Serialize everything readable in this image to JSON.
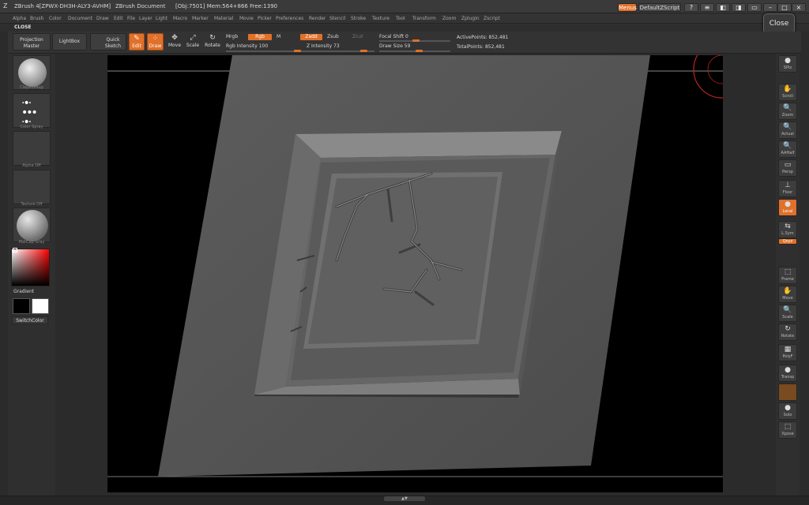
{
  "titlebar": {
    "app": "ZBrush 4[ZPWX-DH3H-ALY3-AVHM]",
    "document": "ZBrush Document",
    "stats": "[Obj:7501] Mem:564+866 Free:1390",
    "menus_label": "Menus",
    "script_label": "DefaultZScript"
  },
  "menubar": [
    "Alpha",
    "Brush",
    "Color",
    "Document",
    "Draw",
    "Edit",
    "File",
    "Layer",
    "Light",
    "Macro",
    "Marker",
    "Material",
    "Movie",
    "Picker",
    "Preferences",
    "Render",
    "Stencil",
    "Stroke",
    "Texture",
    "Tool",
    "Transform",
    "Zoom",
    "Zplugin",
    "Zscript"
  ],
  "closebar": {
    "label": "CLOSE"
  },
  "close_button": "Close",
  "toolbar": {
    "projection_master": [
      "Projection",
      "Master"
    ],
    "lightbox": "LightBox",
    "quick_sketch": [
      "Quick",
      "Sketch"
    ],
    "edit": "Edit",
    "draw": "Draw",
    "move": "Move",
    "scale": "Scale",
    "rotate": "Rotate",
    "mrgb": "Mrgb",
    "rgb": "Rgb",
    "m": "M",
    "rgb_intensity": "Rgb Intensity 100",
    "zadd": "Zadd",
    "zsub": "Zsub",
    "zcut": "Zcut",
    "z_intensity": "Z Intensity 73",
    "focal_shift": "Focal Shift 0",
    "draw_size": "Draw Size 59",
    "active_points": "ActivePoints: 852,481",
    "total_points": "TotalPoints: 852,481"
  },
  "leftpanel": {
    "brush_caption": "ClayBuildup",
    "stroke_caption": "Color Spray",
    "alpha_caption": "Alpha Off",
    "texture_caption": "Texture Off",
    "material_caption": "MatCap Gray",
    "gradient": "Gradient",
    "switch_color": "SwitchColor"
  },
  "rightpanel": [
    {
      "name": "spix",
      "label": "SPix",
      "icon": "●"
    },
    {
      "name": "scroll",
      "label": "Scroll",
      "icon": "✋"
    },
    {
      "name": "zoom",
      "label": "Zoom",
      "icon": "🔍"
    },
    {
      "name": "actual",
      "label": "Actual",
      "icon": "🔍"
    },
    {
      "name": "aahalf",
      "label": "AAHalf",
      "icon": "🔍"
    },
    {
      "name": "persp",
      "label": "Persp",
      "icon": "▭"
    },
    {
      "name": "floor",
      "label": "Floor",
      "icon": "⊥"
    },
    {
      "name": "local",
      "label": "Local",
      "icon": "●"
    },
    {
      "name": "lsym",
      "label": "L.Sym",
      "icon": "⇆"
    },
    {
      "name": "xyz",
      "label": "Qxyz",
      "icon": ""
    },
    {
      "name": "frame",
      "label": "Frame",
      "icon": "⬚"
    },
    {
      "name": "move",
      "label": "Move",
      "icon": "✋"
    },
    {
      "name": "scale",
      "label": "Scale",
      "icon": "🔍"
    },
    {
      "name": "rotate",
      "label": "Rotate",
      "icon": "↻"
    },
    {
      "name": "polyf",
      "label": "PolyF",
      "icon": "▦"
    },
    {
      "name": "transp",
      "label": "Transp",
      "icon": "●"
    },
    {
      "name": "ghost",
      "label": "",
      "icon": ""
    },
    {
      "name": "solo",
      "label": "Solo",
      "icon": "●"
    },
    {
      "name": "xpose",
      "label": "Xpose",
      "icon": "⬚"
    }
  ],
  "colors": {
    "accent": "#e0702a",
    "panel": "#2f2f2f",
    "viewport": "#000000"
  }
}
